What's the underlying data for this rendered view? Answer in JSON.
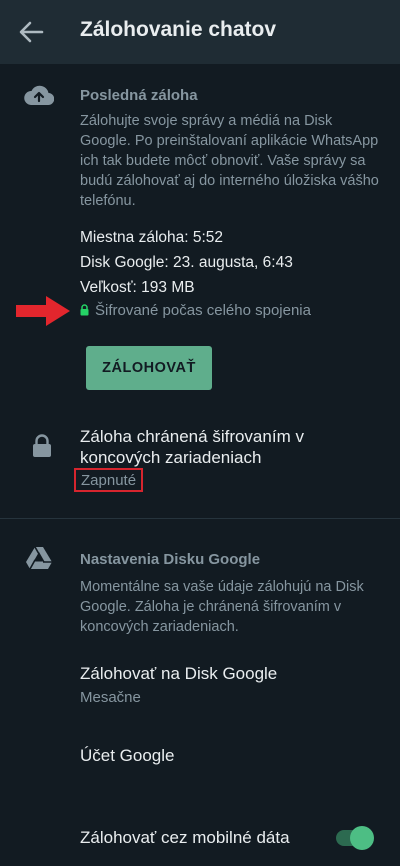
{
  "header": {
    "title": "Zálohovanie chatov"
  },
  "last_backup": {
    "header": "Posledná záloha",
    "description": "Zálohujte svoje správy a médiá na Disk Google. Po preinštalovaní aplikácie WhatsApp ich tak budete môcť obnoviť. Vaše správy sa budú zálohovať aj do interného úložiska vášho telefónu.",
    "local_backup": "Miestna záloha: 5:52",
    "google_drive": "Disk Google: 23. augusta, 6:43",
    "size": "Veľkosť: 193 MB",
    "encryption_note": "Šifrované počas celého spojenia",
    "backup_button": "ZÁLOHOVAŤ"
  },
  "e2e_backup": {
    "title": "Záloha chránená šifrovaním v koncových zariadeniach",
    "status": "Zapnuté"
  },
  "drive_settings": {
    "header": "Nastavenia Disku Google",
    "description": "Momentálne sa vaše údaje zálohujú na Disk Google. Záloha je chránená šifrovaním v koncových zariadeniach.",
    "backup_to_drive_label": "Zálohovať na Disk Google",
    "backup_to_drive_value": "Mesačne",
    "google_account_label": "Účet Google",
    "mobile_data_label": "Zálohovať cez mobilné dáta",
    "mobile_data_enabled": true
  },
  "colors": {
    "background": "#121b22",
    "app_bar": "#1f2c34",
    "accent": "#5fae8c",
    "annotation_red": "#d6252e"
  },
  "icons": [
    "back-arrow-icon",
    "cloud-upload-icon",
    "lock-icon",
    "google-drive-icon",
    "annotation-arrow-icon"
  ]
}
